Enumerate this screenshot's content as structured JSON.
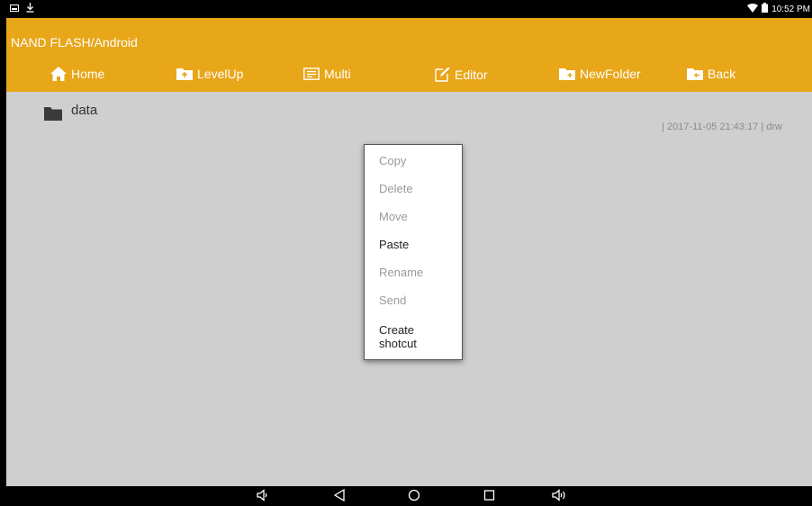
{
  "status_bar": {
    "time": "10:52 PM",
    "left_icons": [
      "screenshot-icon",
      "download-icon"
    ],
    "right_icons": [
      "wifi-icon",
      "battery-icon"
    ]
  },
  "app": {
    "path": "NAND FLASH/Android",
    "toolbar": [
      {
        "id": "home",
        "label": "Home",
        "icon": "home-icon"
      },
      {
        "id": "levelup",
        "label": "LevelUp",
        "icon": "folder-up-icon"
      },
      {
        "id": "multi",
        "label": "Multi",
        "icon": "multi-select-icon"
      },
      {
        "id": "editor",
        "label": "Editor",
        "icon": "edit-icon"
      },
      {
        "id": "newfolder",
        "label": "NewFolder",
        "icon": "new-folder-icon"
      },
      {
        "id": "back",
        "label": "Back",
        "icon": "folder-back-icon"
      }
    ]
  },
  "files": [
    {
      "name": "data",
      "meta": "| 2017-11-05 21:43:17 | drw",
      "icon": "folder-icon"
    }
  ],
  "context_menu": {
    "items": [
      {
        "label": "Copy",
        "enabled": false
      },
      {
        "label": "Delete",
        "enabled": false
      },
      {
        "label": "Move",
        "enabled": false
      },
      {
        "label": "Paste",
        "enabled": true
      },
      {
        "label": "Rename",
        "enabled": false
      },
      {
        "label": "Send",
        "enabled": false
      },
      {
        "label": "Create\nshotcut",
        "label_line1": "Create",
        "label_line2": "shotcut",
        "enabled": true
      }
    ]
  },
  "nav_bar": {
    "buttons": [
      "volume-down-icon",
      "back-icon",
      "home-circle-icon",
      "recents-icon",
      "volume-up-icon"
    ]
  },
  "colors": {
    "appbar": "#e8a619",
    "content_dimmed": "#cfcfcf"
  }
}
